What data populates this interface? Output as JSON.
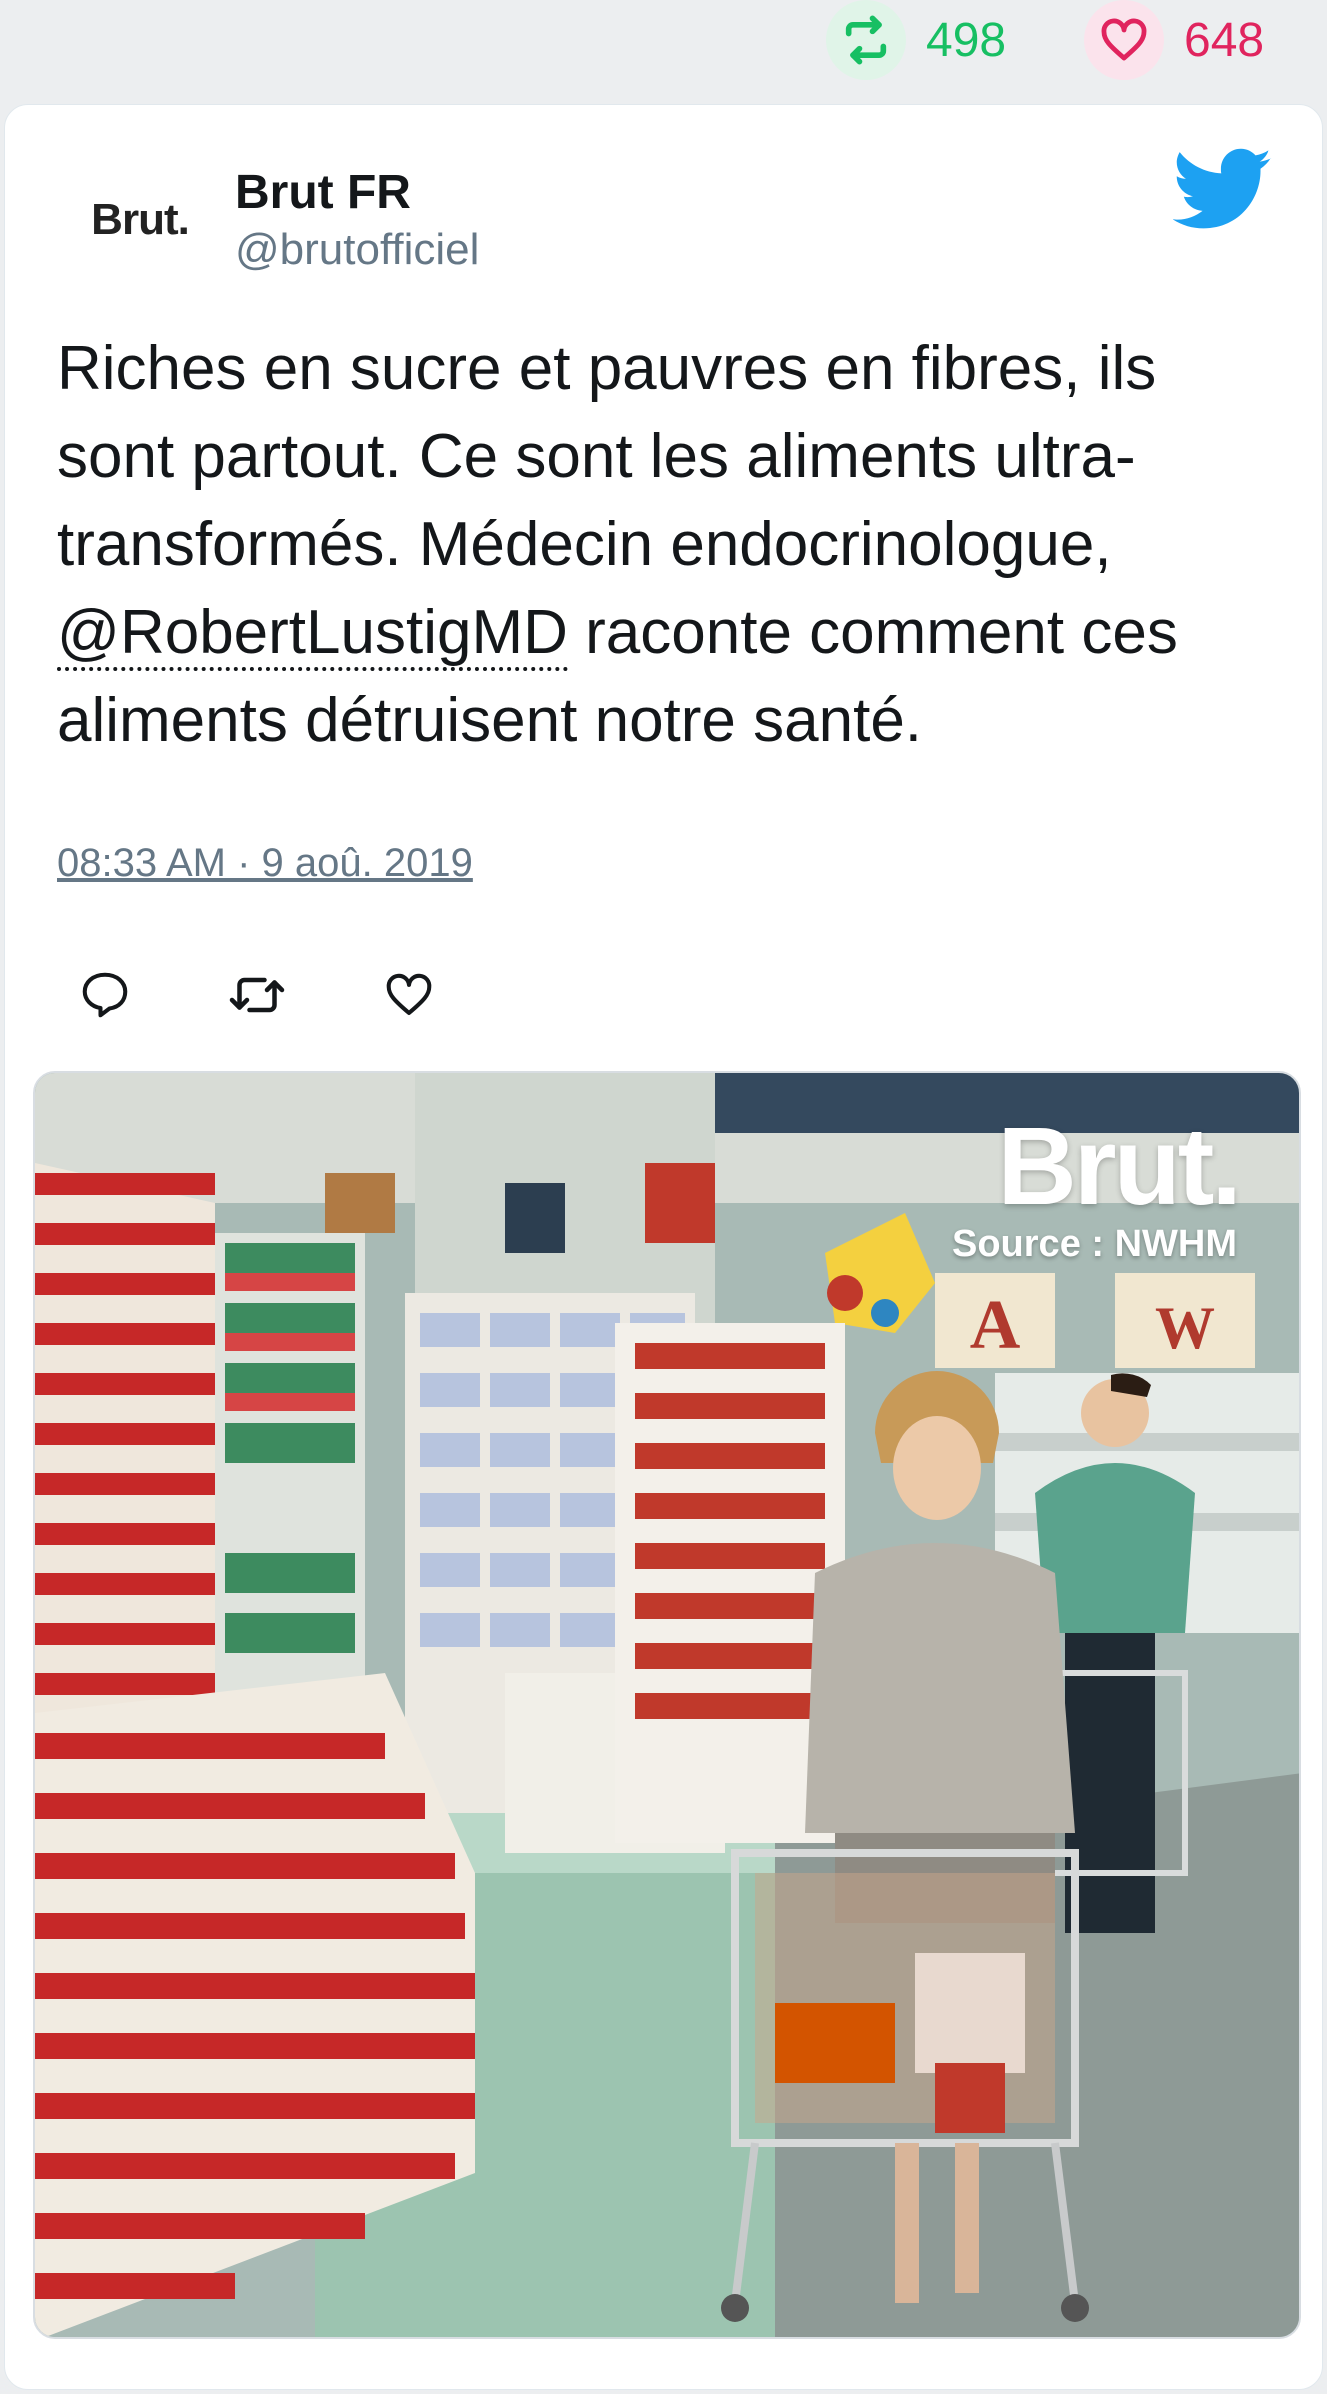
{
  "engagement": {
    "retweet_count": "498",
    "like_count": "648",
    "retweet_color": "#17bf63",
    "like_color": "#e0245e"
  },
  "author": {
    "avatar_text": "Brut.",
    "name": "Brut FR",
    "handle": "@brutofficiel"
  },
  "tweet": {
    "text_before": "Riches en sucre et pauvres en fibres, ils sont partout. Ce sont les aliments ultra-transformés. Médecin endocrinologue, ",
    "mention": "@RobertLustigMD",
    "text_after": " raconte comment ces aliments détruisent notre santé.",
    "timestamp": "08:33 AM · 9 aoû. 2019"
  },
  "actions": {
    "icons": [
      "reply-icon",
      "retweet-icon",
      "like-icon"
    ]
  },
  "media": {
    "watermark_brand": "Brut.",
    "watermark_source": "Source : NWHM",
    "sign_letters": [
      "A",
      "W"
    ]
  },
  "icons": {
    "brand": "twitter-bird-icon",
    "brand_color": "#1da1f2"
  }
}
